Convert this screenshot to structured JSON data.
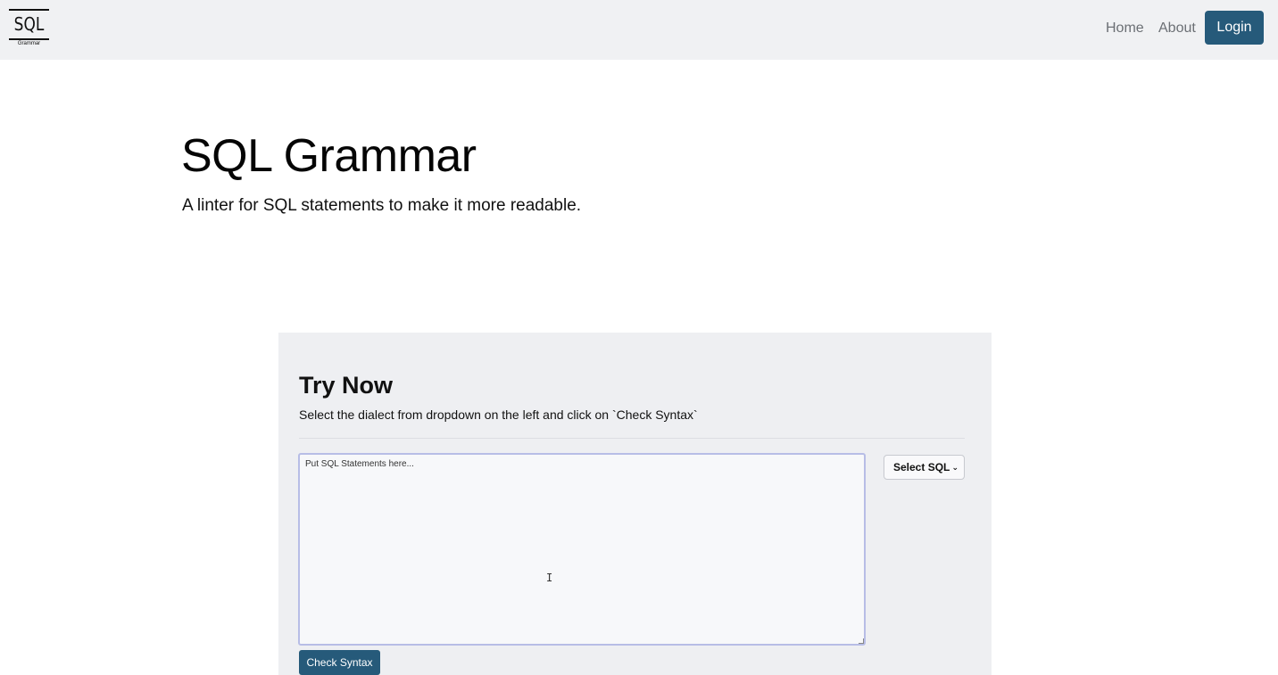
{
  "brand": {
    "logo_text": "SQL",
    "logo_subtext": "Grammar"
  },
  "nav": {
    "home_label": "Home",
    "about_label": "About",
    "login_label": "Login"
  },
  "hero": {
    "title": "SQL Grammar",
    "subtitle": "A linter for SQL statements to make it more readable."
  },
  "demo": {
    "title": "Try Now",
    "description": "Select the dialect from dropdown on the left and click on `Check Syntax`",
    "input_placeholder": "Put SQL Statements here...",
    "input_value": "",
    "dialect_selected": "Select SQL",
    "check_button_label": "Check Syntax"
  },
  "colors": {
    "navbar_bg": "#f0f1f3",
    "primary": "#265a7a",
    "demo_bg": "#eeeff2"
  }
}
